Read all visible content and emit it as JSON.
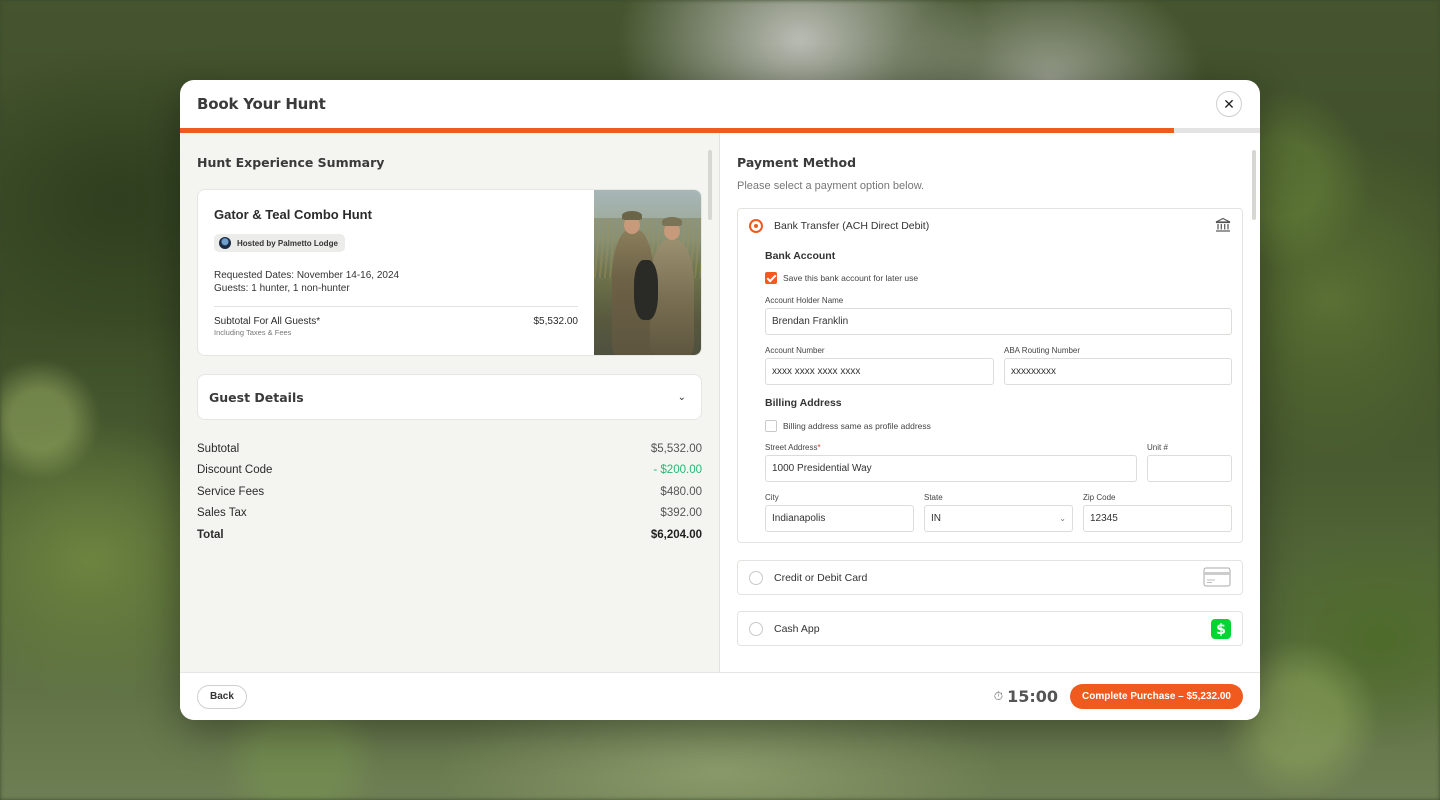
{
  "modal": {
    "title": "Book Your Hunt",
    "close_icon": "close-icon",
    "progress_percent": 92
  },
  "summary": {
    "title": "Hunt Experience Summary",
    "hunt_name": "Gator & Teal Combo Hunt",
    "host_label": "Hosted by Palmetto Lodge",
    "requested_dates": "Requested Dates: November 14-16, 2024",
    "guests": "Guests: 1 hunter, 1 non-hunter",
    "subtotal_label": "Subtotal For All Guests*",
    "subtotal_note": "Including Taxes & Fees",
    "subtotal_value": "$5,532.00"
  },
  "guest_details": {
    "title": "Guest Details",
    "chevron_icon": "chevron-down-icon"
  },
  "totals": [
    {
      "label": "Subtotal",
      "value": "$5,532.00"
    },
    {
      "label": "Discount Code",
      "value": "- $200.00"
    },
    {
      "label": "Service Fees",
      "value": "$480.00"
    },
    {
      "label": "Sales Tax",
      "value": "$392.00"
    },
    {
      "label": "Total",
      "value": "$6,204.00"
    }
  ],
  "payment": {
    "title": "Payment Method",
    "subtitle": "Please select a payment option below.",
    "options": [
      {
        "label": "Bank Transfer (ACH Direct Debit)",
        "icon": "bank-icon",
        "selected": true
      },
      {
        "label": "Credit or Debit Card",
        "icon": "credit-card-icon",
        "selected": false
      },
      {
        "label": "Cash App",
        "icon": "cash-app-icon",
        "selected": false
      }
    ],
    "bank": {
      "heading": "Bank Account",
      "save_label": "Save this bank account for later use",
      "save_checked": true,
      "holder_label": "Account Holder Name",
      "holder_value": "Brendan Franklin",
      "account_label": "Account Number",
      "account_value": "xxxx xxxx xxxx xxxx",
      "routing_label": "ABA Routing Number",
      "routing_value": "xxxxxxxxx"
    },
    "billing": {
      "heading": "Billing Address",
      "same_label": "Billing address same as profile address",
      "same_checked": false,
      "street_label": "Street Address",
      "street_required": "*",
      "street_value": "1000 Presidential Way",
      "unit_label": "Unit #",
      "unit_value": "",
      "city_label": "City",
      "city_value": "Indianapolis",
      "state_label": "State",
      "state_value": "IN",
      "zip_label": "Zip Code",
      "zip_value": "12345"
    }
  },
  "footer": {
    "back_label": "Back",
    "timer_icon": "stopwatch-icon",
    "timer": "15:00",
    "complete_label": "Complete Purchase – $5,232.00"
  },
  "colors": {
    "accent": "#f15a1f",
    "discount": "#2bb673",
    "cash_app": "#00d632"
  }
}
